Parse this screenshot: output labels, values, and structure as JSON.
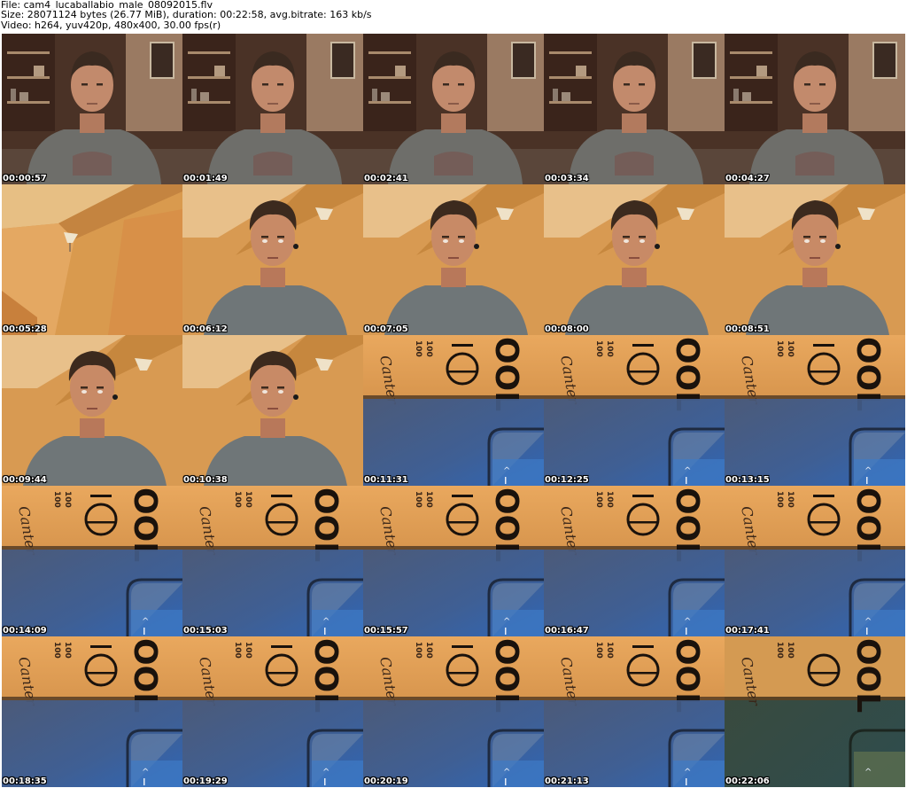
{
  "header": {
    "file": "File: cam4_lucaballabio_male_08092015.flv",
    "size": "Size: 28071124 bytes (26.77 MiB), duration: 00:22:58, avg.bitrate: 163 kb/s",
    "video": "Video: h264, yuv420p, 480x400, 30.00 fps(r)"
  },
  "thumbnails": [
    {
      "time": "00:00:57",
      "scene": "room-portrait"
    },
    {
      "time": "00:01:49",
      "scene": "room-portrait"
    },
    {
      "time": "00:02:41",
      "scene": "room-portrait"
    },
    {
      "time": "00:03:34",
      "scene": "room-portrait"
    },
    {
      "time": "00:04:27",
      "scene": "room-portrait"
    },
    {
      "time": "00:05:28",
      "scene": "empty-wall"
    },
    {
      "time": "00:06:12",
      "scene": "wall-portrait"
    },
    {
      "time": "00:07:05",
      "scene": "wall-portrait"
    },
    {
      "time": "00:08:00",
      "scene": "wall-portrait"
    },
    {
      "time": "00:08:51",
      "scene": "wall-portrait"
    },
    {
      "time": "00:09:44",
      "scene": "wall-portrait"
    },
    {
      "time": "00:10:38",
      "scene": "wall-portrait"
    },
    {
      "time": "00:11:31",
      "scene": "card-closeup"
    },
    {
      "time": "00:12:25",
      "scene": "card-closeup"
    },
    {
      "time": "00:13:15",
      "scene": "card-closeup"
    },
    {
      "time": "00:14:09",
      "scene": "card-closeup"
    },
    {
      "time": "00:15:03",
      "scene": "card-closeup"
    },
    {
      "time": "00:15:57",
      "scene": "card-closeup"
    },
    {
      "time": "00:16:47",
      "scene": "card-closeup"
    },
    {
      "time": "00:17:41",
      "scene": "card-closeup"
    },
    {
      "time": "00:18:35",
      "scene": "card-closeup"
    },
    {
      "time": "00:19:29",
      "scene": "card-closeup"
    },
    {
      "time": "00:20:19",
      "scene": "card-closeup"
    },
    {
      "time": "00:21:13",
      "scene": "card-closeup"
    },
    {
      "time": "00:22:06",
      "scene": "card-closeup-dark"
    }
  ]
}
